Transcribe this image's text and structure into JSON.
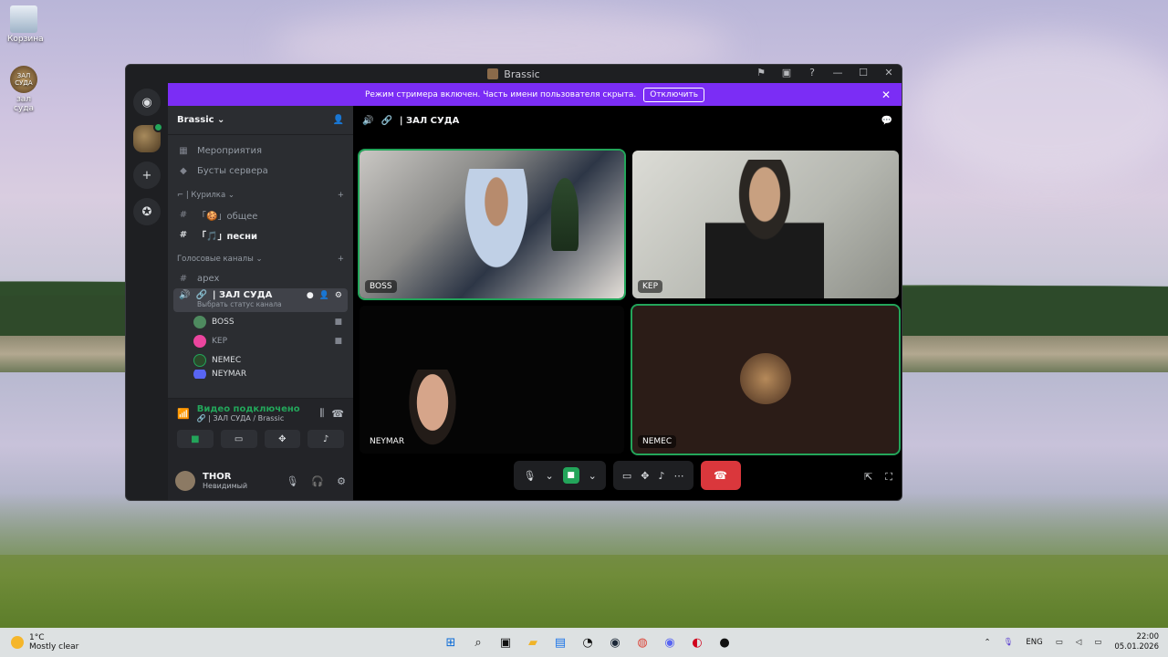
{
  "desktop": {
    "icons": [
      {
        "label": "Корзина"
      },
      {
        "label": "зал суда",
        "image_text": "ЗАЛ СУДА"
      }
    ]
  },
  "window": {
    "title": "Brassic",
    "banner_text": "Режим стримера включен. Часть имени пользователя скрыта.",
    "banner_button": "Отключить"
  },
  "sidebar": {
    "server_name": "Brassic",
    "items": [
      {
        "icon": "calendar-icon",
        "label": "Мероприятия"
      },
      {
        "icon": "boost-icon",
        "label": "Бусты сервера"
      }
    ],
    "category_1": "| Курилка",
    "text_channels": [
      {
        "label": "「🍪」общее",
        "active": false
      },
      {
        "label": "「🎵」песни",
        "active": true
      }
    ],
    "category_2": "Голосовые каналы",
    "voice_channels": [
      {
        "label": "apex"
      }
    ],
    "active_voice": {
      "label": "| ЗАЛ СУДА",
      "sub": "Выбрать статус канала"
    },
    "members": [
      {
        "name": "BOSS",
        "color": "#4e8a5f"
      },
      {
        "name": "KEP",
        "color": "#eb459e"
      },
      {
        "name": "NEMEC",
        "color": "#2a4a2a"
      },
      {
        "name": "NEYMAR",
        "color": "#5865f2"
      }
    ]
  },
  "voice_panel": {
    "status": "Видео подключено",
    "channel": "| ЗАЛ СУДА / Brassic"
  },
  "user": {
    "name": "THOR",
    "status": "Невидимый"
  },
  "call": {
    "header": "| ЗАЛ СУДА",
    "tiles": [
      {
        "name": "BOSS"
      },
      {
        "name": "KEP"
      },
      {
        "name": "NEYMAR"
      },
      {
        "name": "NEMEC"
      }
    ]
  },
  "taskbar": {
    "temperature": "1°C",
    "weather": "Mostly clear",
    "lang": "ENG",
    "time": "22:00",
    "date": "05.01.2026"
  }
}
